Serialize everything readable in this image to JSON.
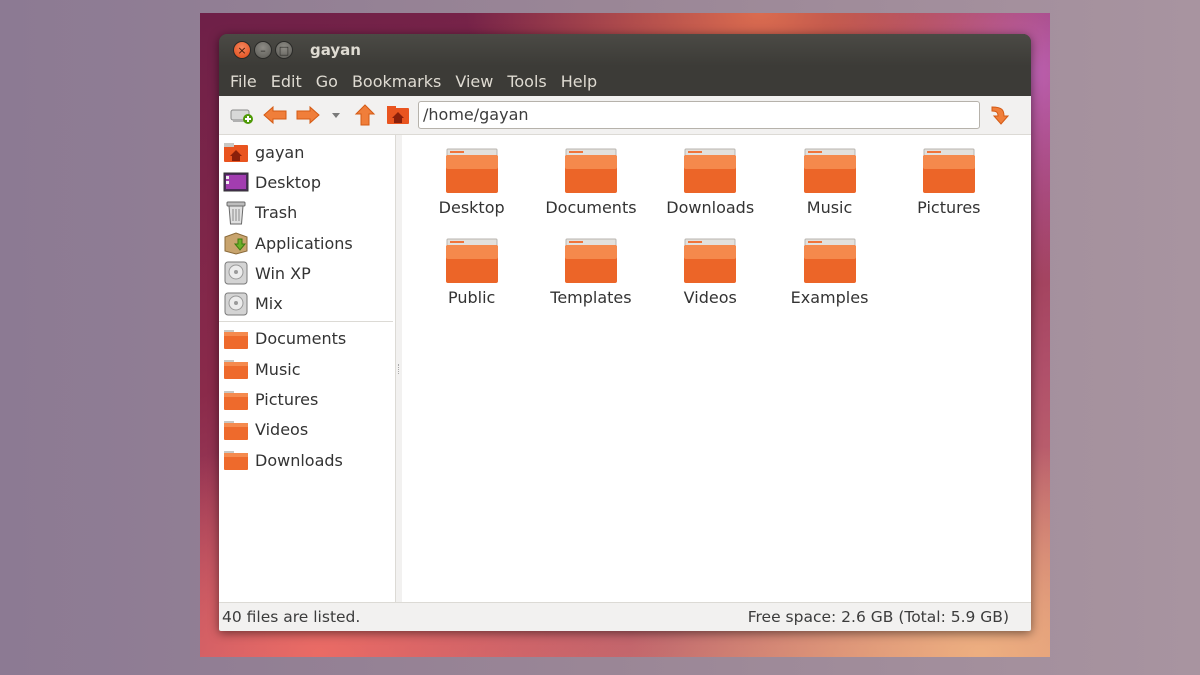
{
  "window": {
    "title": "gayan",
    "controls": {
      "close": "×",
      "minimize": "–",
      "maximize": "□"
    }
  },
  "menu": [
    "File",
    "Edit",
    "Go",
    "Bookmarks",
    "View",
    "Tools",
    "Help"
  ],
  "toolbar": {
    "icons": [
      "new-tab-icon",
      "back-arrow-icon",
      "forward-arrow-icon",
      "history-dropdown-icon",
      "up-arrow-icon",
      "home-icon",
      "go-icon"
    ],
    "location": "/home/gayan"
  },
  "sidebar": {
    "places": [
      {
        "label": "gayan",
        "icon": "home-folder-icon"
      },
      {
        "label": "Desktop",
        "icon": "desktop-icon"
      },
      {
        "label": "Trash",
        "icon": "trash-icon"
      },
      {
        "label": "Applications",
        "icon": "applications-icon"
      },
      {
        "label": "Win XP",
        "icon": "drive-icon"
      },
      {
        "label": "Mix",
        "icon": "drive-icon"
      }
    ],
    "bookmarks": [
      {
        "label": "Documents",
        "icon": "folder-icon"
      },
      {
        "label": "Music",
        "icon": "folder-icon"
      },
      {
        "label": "Pictures",
        "icon": "folder-icon"
      },
      {
        "label": "Videos",
        "icon": "folder-icon"
      },
      {
        "label": "Downloads",
        "icon": "folder-icon"
      }
    ]
  },
  "content": {
    "items": [
      {
        "label": "Desktop",
        "icon": "folder-icon"
      },
      {
        "label": "Documents",
        "icon": "folder-icon"
      },
      {
        "label": "Downloads",
        "icon": "folder-icon"
      },
      {
        "label": "Music",
        "icon": "folder-icon"
      },
      {
        "label": "Pictures",
        "icon": "folder-icon"
      },
      {
        "label": "Public",
        "icon": "folder-icon"
      },
      {
        "label": "Templates",
        "icon": "folder-icon"
      },
      {
        "label": "Videos",
        "icon": "folder-icon"
      },
      {
        "label": "Examples",
        "icon": "folder-icon"
      }
    ]
  },
  "status": {
    "left": "40 files are listed.",
    "right": "Free space: 2.6 GB (Total: 5.9 GB)"
  },
  "colors": {
    "accent": "#e9541f",
    "titlebar": "#3c3b37",
    "toolbar": "#f2f1f0",
    "folder_orange": "#f06a2c"
  }
}
